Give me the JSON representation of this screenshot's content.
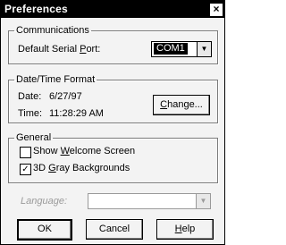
{
  "window": {
    "title": "Preferences",
    "close_glyph": "×"
  },
  "communications": {
    "legend": "Communications",
    "port_label_pre": "Default Serial ",
    "port_label_ul": "P",
    "port_label_post": "ort:",
    "port_value": "COM1"
  },
  "datetime": {
    "legend": "Date/Time Format",
    "date_label": "Date:",
    "date_value": "6/27/97",
    "time_label": "Time:",
    "time_value": "11:28:29 AM",
    "change_ul": "C",
    "change_rest": "hange..."
  },
  "general": {
    "legend": "General",
    "welcome_pre": "Show ",
    "welcome_ul": "W",
    "welcome_post": "elcome Screen",
    "welcome_checked": false,
    "gray_pre": "3D ",
    "gray_ul": "G",
    "gray_post": "ray Backgrounds",
    "gray_checked": true,
    "check_glyph": "✓"
  },
  "language": {
    "label": "Language:",
    "value": "",
    "enabled": false
  },
  "buttons": {
    "ok": "OK",
    "cancel": "Cancel",
    "help_ul": "H",
    "help_rest": "elp"
  },
  "icons": {
    "dropdown": "▼"
  }
}
